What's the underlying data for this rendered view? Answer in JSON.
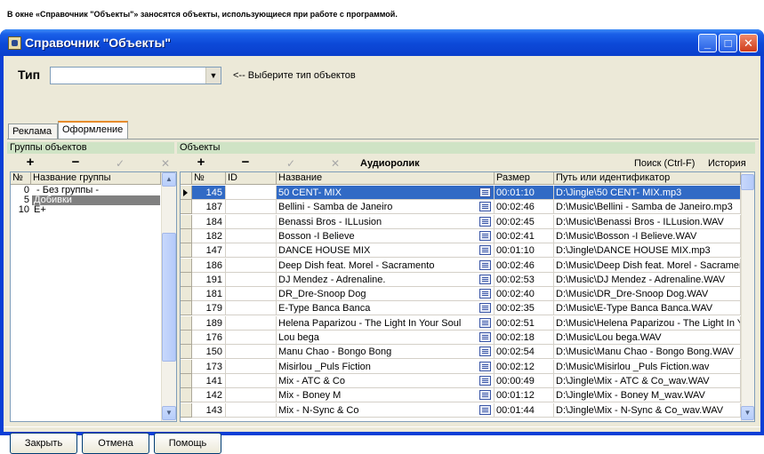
{
  "caption": "В окне «Справочник \"Объекты\"» заносятся объекты, использующиеся при работе с программой.",
  "window": {
    "title": "Справочник \"Объекты\"",
    "minimize": "_",
    "maximize": "□",
    "close": "✕"
  },
  "type_selector": {
    "label": "Тип",
    "value": "",
    "hint": "<-- Выберите тип объектов",
    "arrow": "▼"
  },
  "tabs": [
    {
      "label": "Реклама",
      "active": false
    },
    {
      "label": "Оформление",
      "active": true
    }
  ],
  "groups_panel": {
    "title": "Группы объектов",
    "toolbar": {
      "add": "+",
      "remove": "−",
      "confirm": "✓",
      "cancel": "✕"
    },
    "columns": [
      "№",
      "Название группы"
    ],
    "rows": [
      {
        "num": "0",
        "name": " - Без группы -",
        "selected": false
      },
      {
        "num": "5",
        "name": "Добивки",
        "selected": true
      },
      {
        "num": "10",
        "name": "Е+",
        "selected": false
      }
    ]
  },
  "objects_panel": {
    "title": "Объекты",
    "toolbar": {
      "add": "+",
      "remove": "−",
      "confirm": "✓",
      "cancel": "✕",
      "type_name": "Аудиоролик",
      "search": "Поиск (Ctrl-F)",
      "history": "История"
    },
    "columns": [
      "№",
      "ID",
      "Название",
      "Размер",
      "Путь или идентификатор"
    ],
    "rows": [
      {
        "num": "145",
        "id": "",
        "name": "50 CENT- MIX",
        "size": "00:01:10",
        "path": "D:\\Jingle\\50 CENT- MIX.mp3",
        "selected": true
      },
      {
        "num": "187",
        "id": "",
        "name": "Bellini - Samba de Janeiro",
        "size": "00:02:46",
        "path": "D:\\Music\\Bellini - Samba de Janeiro.mp3",
        "selected": false
      },
      {
        "num": "184",
        "id": "",
        "name": "Benassi Bros - ILLusion",
        "size": "00:02:45",
        "path": "D:\\Music\\Benassi Bros - ILLusion.WAV",
        "selected": false
      },
      {
        "num": "182",
        "id": "",
        "name": "Bosson -I Believe",
        "size": "00:02:41",
        "path": "D:\\Music\\Bosson -I Believe.WAV",
        "selected": false
      },
      {
        "num": "147",
        "id": "",
        "name": "DANCE HOUSE MIX",
        "size": "00:01:10",
        "path": "D:\\Jingle\\DANCE HOUSE MIX.mp3",
        "selected": false
      },
      {
        "num": "186",
        "id": "",
        "name": "Deep Dish feat. Morel - Sacramento",
        "size": "00:02:46",
        "path": "D:\\Music\\Deep Dish feat. Morel - Sacramen",
        "selected": false
      },
      {
        "num": "191",
        "id": "",
        "name": "DJ Mendez - Adrenaline.",
        "size": "00:02:53",
        "path": "D:\\Music\\DJ Mendez - Adrenaline.WAV",
        "selected": false
      },
      {
        "num": "181",
        "id": "",
        "name": "DR_Dre-Snoop Dog",
        "size": "00:02:40",
        "path": "D:\\Music\\DR_Dre-Snoop Dog.WAV",
        "selected": false
      },
      {
        "num": "179",
        "id": "",
        "name": "E-Type  Banca Banca",
        "size": "00:02:35",
        "path": "D:\\Music\\E-Type  Banca Banca.WAV",
        "selected": false
      },
      {
        "num": "189",
        "id": "",
        "name": "Helena Paparizou - The Light In Your Soul",
        "size": "00:02:51",
        "path": "D:\\Music\\Helena Paparizou - The Light In Y",
        "selected": false
      },
      {
        "num": "176",
        "id": "",
        "name": "Lou bega",
        "size": "00:02:18",
        "path": "D:\\Music\\Lou bega.WAV",
        "selected": false
      },
      {
        "num": "150",
        "id": "",
        "name": "Manu Chao - Bongo Bong",
        "size": "00:02:54",
        "path": "D:\\Music\\Manu Chao - Bongo Bong.WAV",
        "selected": false
      },
      {
        "num": "173",
        "id": "",
        "name": "Misirlou _Puls Fiction",
        "size": "00:02:12",
        "path": "D:\\Music\\Misirlou _Puls Fiction.wav",
        "selected": false
      },
      {
        "num": "141",
        "id": "",
        "name": "Mix - ATC & Co",
        "size": "00:00:49",
        "path": "D:\\Jingle\\Mix - ATC & Co_wav.WAV",
        "selected": false
      },
      {
        "num": "142",
        "id": "",
        "name": "Mix - Boney M",
        "size": "00:01:12",
        "path": "D:\\Jingle\\Mix - Boney M_wav.WAV",
        "selected": false
      },
      {
        "num": "143",
        "id": "",
        "name": "Mix - N-Sync & Co",
        "size": "00:01:44",
        "path": "D:\\Jingle\\Mix - N-Sync & Co_wav.WAV",
        "selected": false
      }
    ]
  },
  "footer": {
    "close": "Закрыть",
    "cancel": "Отмена",
    "help": "Помощь"
  },
  "colors": {
    "title_bar": "#0a3fd6",
    "selection": "#316ac5",
    "panel_header": "#cfe3c5",
    "group_selection": "#808080"
  },
  "icons": [
    "app-icon",
    "combo-arrow-icon",
    "memo-icon",
    "row-indicator-icon",
    "scroll-up-icon",
    "scroll-down-icon"
  ]
}
